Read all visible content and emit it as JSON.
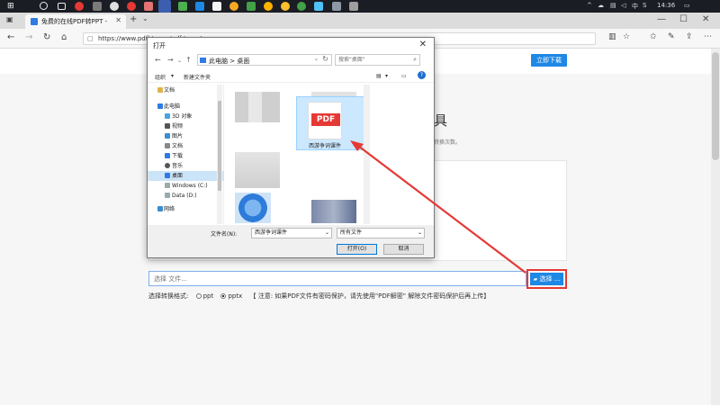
{
  "colors": {
    "accent": "#1e88e5",
    "highlight": "#e53935",
    "selection": "#cce4f7"
  },
  "taskbar": {
    "icons": [
      "windows-icon",
      "search-icon",
      "task-view-icon",
      "app-icon",
      "app-icon",
      "app-icon",
      "app-icon",
      "app-icon",
      "app-icon",
      "app-icon",
      "app-icon",
      "app-icon",
      "app-icon",
      "app-icon",
      "app-icon",
      "app-icon"
    ],
    "language": "中",
    "time": "14:36"
  },
  "browser": {
    "tab_title": "免费的在线PDF转PPT -",
    "url": "https://www.pdfkt.com/pdf-to-ppt"
  },
  "page": {
    "download_button": "立即下载",
    "heading": "具",
    "subtext": "转换次数。",
    "file_input_placeholder": "选择 文件...",
    "choose_button": "选择 ...",
    "format_label": "选择转换格式:",
    "format_options": [
      "ppt",
      "pptx"
    ],
    "selected_format": "pptx",
    "notice": "【 注意: 如果PDF文件有密码保护，请先使用\"PDF解密\" 解除文件密码保护后再上传】"
  },
  "dialog": {
    "title": "打开",
    "path": [
      "此电脑",
      "桌面"
    ],
    "search_placeholder": "搜索\"桌面\"",
    "toolbar": {
      "organize": "组织",
      "new_folder": "新建文件夹"
    },
    "nav_items": [
      {
        "label": "文档",
        "icon": "folder-icon"
      },
      {
        "label": "此电脑",
        "icon": "computer-icon"
      },
      {
        "label": "3D 对象",
        "icon": "folder-3d-icon"
      },
      {
        "label": "视频",
        "icon": "video-icon"
      },
      {
        "label": "图片",
        "icon": "picture-icon"
      },
      {
        "label": "文档",
        "icon": "document-icon"
      },
      {
        "label": "下载",
        "icon": "download-icon"
      },
      {
        "label": "音乐",
        "icon": "music-icon"
      },
      {
        "label": "桌面",
        "icon": "desktop-icon"
      },
      {
        "label": "Windows (C:)",
        "icon": "drive-icon"
      },
      {
        "label": "Data (D:)",
        "icon": "drive-icon"
      },
      {
        "label": "网络",
        "icon": "network-icon"
      }
    ],
    "selected_nav": "桌面",
    "pdf_file": {
      "badge": "PDF",
      "name": "西游争词课件"
    },
    "filename_label": "文件名(N):",
    "filename_value": "西游争词课件",
    "filetype": "所有文件",
    "open_button": "打开(O)",
    "cancel_button": "取消"
  }
}
